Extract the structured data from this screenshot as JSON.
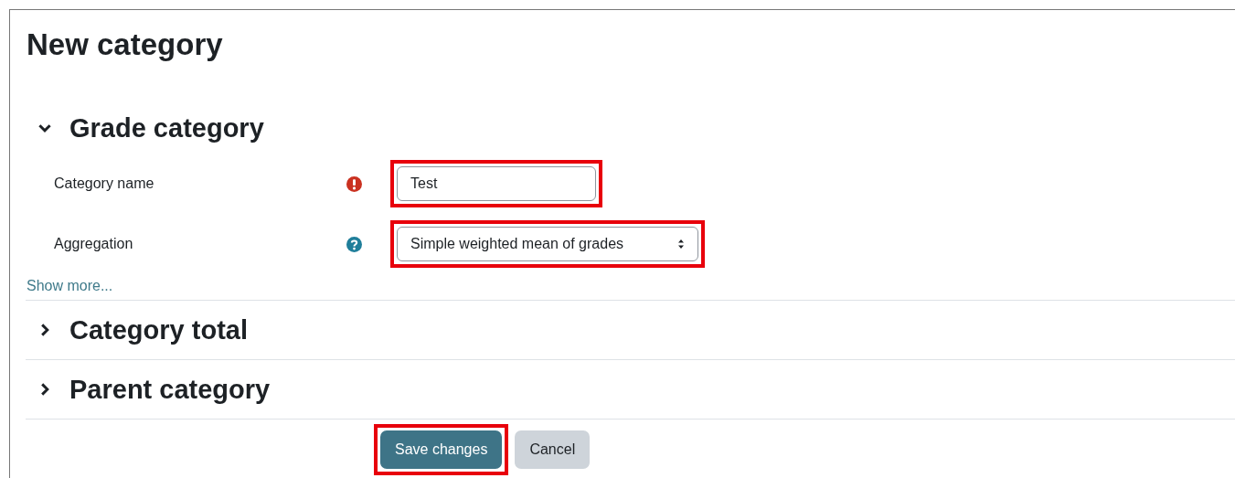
{
  "title": "New category",
  "sections": [
    {
      "title": "Grade category",
      "expanded": true,
      "fields": [
        {
          "label": "Category name",
          "required": true,
          "help": false,
          "kind": "text",
          "value": "Test",
          "highlighted": true
        },
        {
          "label": "Aggregation",
          "required": false,
          "help": true,
          "kind": "select",
          "value": "Simple weighted mean of grades",
          "highlighted": true
        }
      ],
      "show_more": "Show more..."
    },
    {
      "title": "Category total",
      "expanded": false
    },
    {
      "title": "Parent category",
      "expanded": false
    }
  ],
  "buttons": [
    {
      "label": "Save changes",
      "kind": "primary",
      "highlighted": true
    },
    {
      "label": "Cancel",
      "kind": "secondary",
      "highlighted": false
    }
  ]
}
